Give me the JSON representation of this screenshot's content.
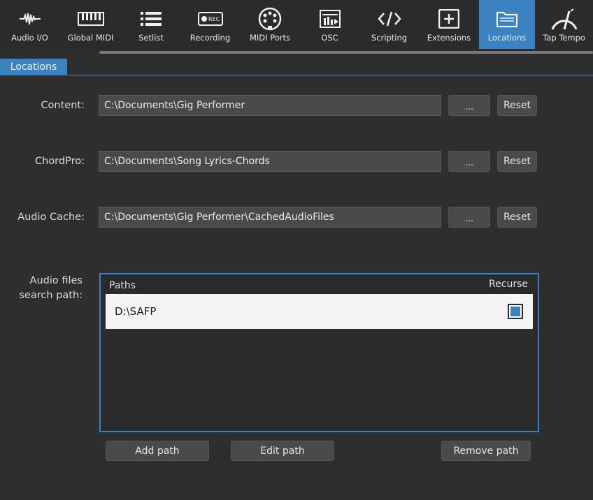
{
  "toolbar": {
    "items": [
      {
        "label": "Audio I/O",
        "icon": "waveform-icon"
      },
      {
        "label": "Global MIDI",
        "icon": "keyboard-icon"
      },
      {
        "label": "Setlist",
        "icon": "list-icon"
      },
      {
        "label": "Recording",
        "icon": "rec-icon"
      },
      {
        "label": "MIDI Ports",
        "icon": "midi-port-icon"
      },
      {
        "label": "OSC",
        "icon": "osc-icon"
      },
      {
        "label": "Scripting",
        "icon": "code-icon"
      },
      {
        "label": "Extensions",
        "icon": "plus-box-icon"
      },
      {
        "label": "Locations",
        "icon": "folder-icon"
      },
      {
        "label": "Tap Tempo",
        "icon": "gauge-icon"
      }
    ],
    "active": "Locations",
    "rec_icon_text": "REC"
  },
  "tab": {
    "label": "Locations"
  },
  "rows": [
    {
      "label": "Content:",
      "value": "C:\\Documents\\Gig Performer",
      "browse": "...",
      "reset": "Reset"
    },
    {
      "label": "ChordPro:",
      "value": "C:\\Documents\\Song Lyrics-Chords",
      "browse": "...",
      "reset": "Reset"
    },
    {
      "label": "Audio Cache:",
      "value": "C:\\Documents\\Gig Performer\\CachedAudioFiles",
      "browse": "...",
      "reset": "Reset"
    }
  ],
  "search": {
    "label_line1": "Audio files",
    "label_line2": "search path:",
    "col_paths": "Paths",
    "col_recurse": "Recurse",
    "entries": [
      {
        "path": "D:\\SAFP",
        "recurse": true
      }
    ],
    "add": "Add path",
    "edit": "Edit path",
    "remove": "Remove path"
  },
  "colors": {
    "accent": "#3b82c0",
    "background": "#2e2e2e"
  }
}
